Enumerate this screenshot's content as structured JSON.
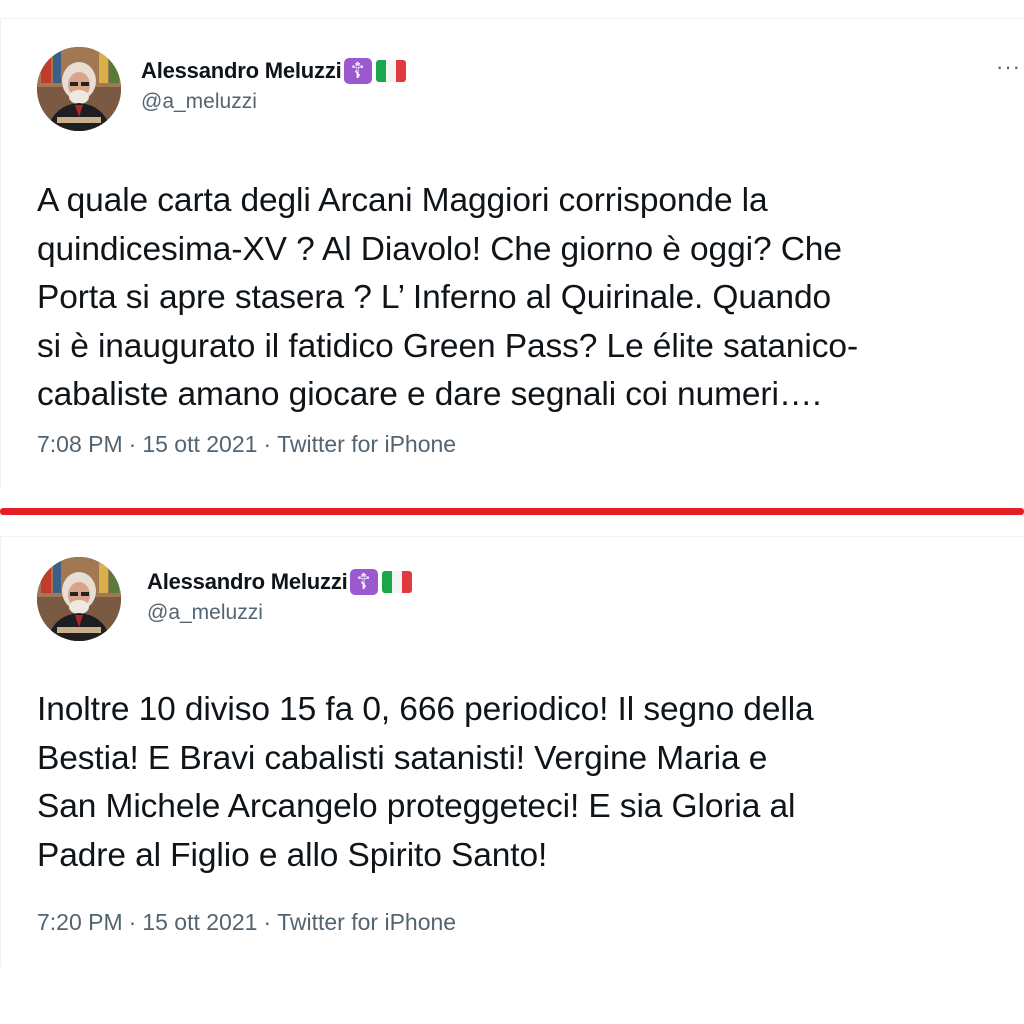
{
  "tweets": [
    {
      "display_name": "Alessandro Meluzzi",
      "badge_cross": "☦",
      "handle": "@a_meluzzi",
      "more": "···",
      "text": "A quale carta degli Arcani Maggiori corrisponde la\nquindicesima-XV ? Al Diavolo! Che giorno è oggi? Che\nPorta si apre stasera ? L’ Inferno al Quirinale.  Quando\nsi è inaugurato il fatidico Green Pass? Le élite satanico-\ncabaliste amano giocare e dare segnali coi numeri….",
      "time": "7:08 PM",
      "date": "15 ott 2021",
      "source": "Twitter for iPhone"
    },
    {
      "display_name": "Alessandro Meluzzi",
      "badge_cross": "☦",
      "handle": "@a_meluzzi",
      "text": "Inoltre 10 diviso 15 fa 0, 666 periodico! Il segno della\nBestia!  E Bravi cabalisti satanisti!  Vergine Maria  e\nSan Michele Arcangelo proteggeteci! E sia Gloria al\nPadre al Figlio e allo Spirito Santo!",
      "time": "7:20 PM",
      "date": "15 ott 2021",
      "source": "Twitter for iPhone"
    }
  ],
  "separator_dot": "·",
  "colors": {
    "divider": "#e31e24",
    "badge": "#9b59d0",
    "secondary_text": "#536471",
    "primary_text": "#0f1419"
  },
  "icons": {
    "badge": "orthodox-cross-icon",
    "flag": "italian-flag-icon",
    "more": "more-options-icon"
  }
}
